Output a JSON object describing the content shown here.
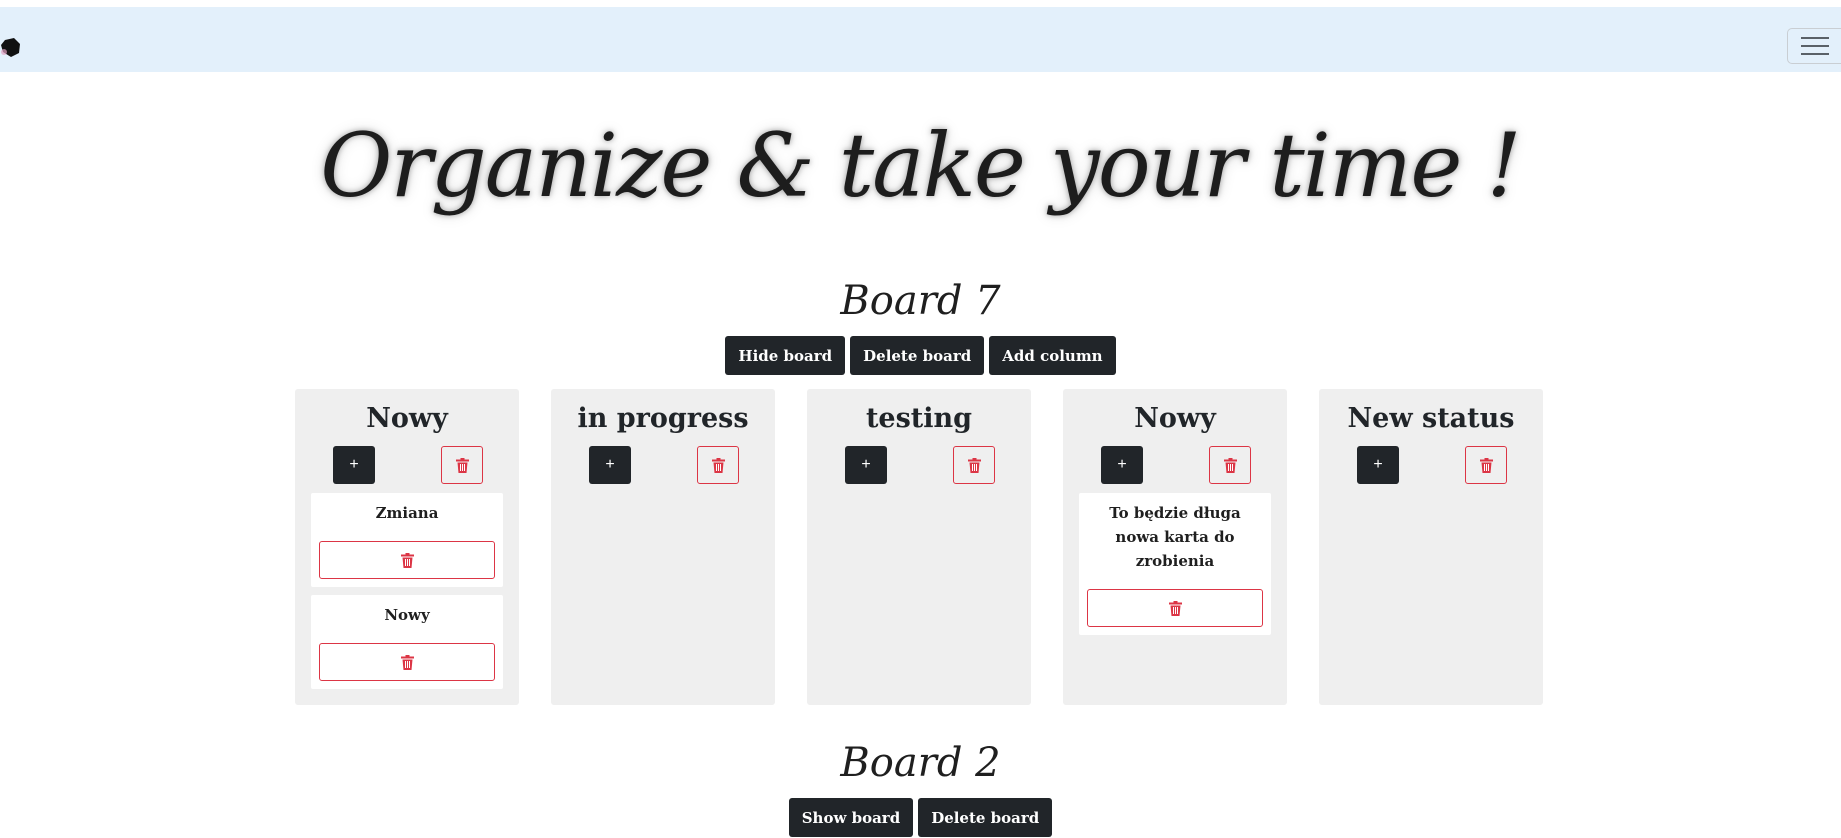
{
  "navbar": {
    "logo_icon": "blob-logo-icon",
    "menu_icon": "hamburger-icon"
  },
  "hero": {
    "text": "Organize & take your time !"
  },
  "boards": [
    {
      "title": "Board 7",
      "buttons": {
        "hide": "Hide board",
        "delete": "Delete board",
        "add_column": "Add column"
      },
      "columns": [
        {
          "title": "Nowy",
          "add_label": "+",
          "cards": [
            {
              "text": "Zmiana"
            },
            {
              "text": "Nowy"
            }
          ]
        },
        {
          "title": "in progress",
          "add_label": "+",
          "cards": []
        },
        {
          "title": "testing",
          "add_label": "+",
          "cards": []
        },
        {
          "title": "Nowy",
          "add_label": "+",
          "cards": [
            {
              "text": "To będzie długa nowa karta do zrobienia"
            }
          ]
        },
        {
          "title": "New status",
          "add_label": "+",
          "cards": []
        }
      ]
    },
    {
      "title": "Board 2",
      "buttons": {
        "show": "Show board",
        "delete": "Delete board"
      }
    }
  ],
  "colors": {
    "dark": "#212529",
    "danger": "#dc3545",
    "navbar_bg": "#e3f0fb",
    "column_bg": "#efefef"
  }
}
